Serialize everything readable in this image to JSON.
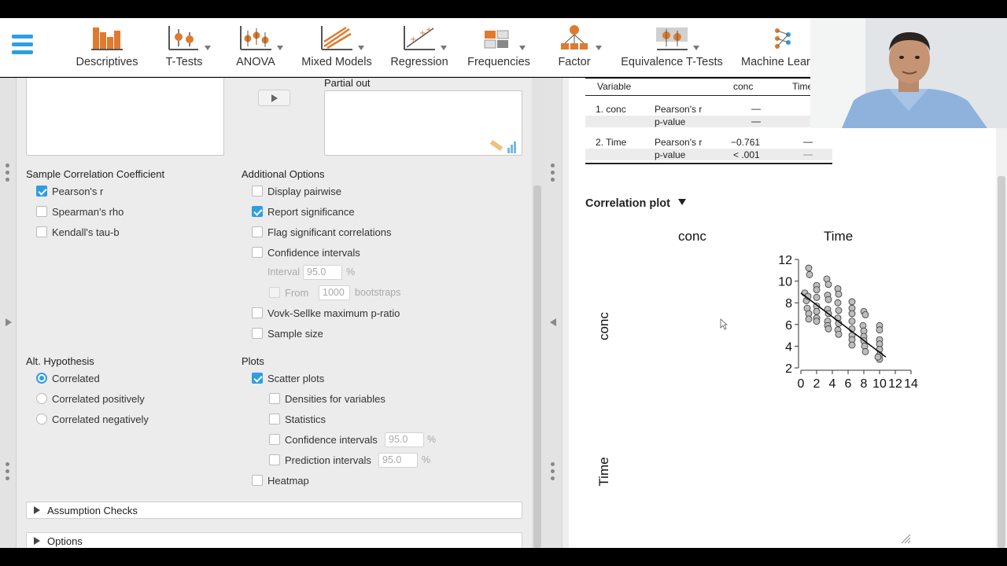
{
  "ribbon": {
    "items": [
      {
        "label": "Descriptives",
        "icon": "descriptives-icon"
      },
      {
        "label": "T-Tests",
        "icon": "t-tests-icon"
      },
      {
        "label": "ANOVA",
        "icon": "anova-icon"
      },
      {
        "label": "Mixed Models",
        "icon": "mixed-models-icon"
      },
      {
        "label": "Regression",
        "icon": "regression-icon"
      },
      {
        "label": "Frequencies",
        "icon": "frequencies-icon"
      },
      {
        "label": "Factor",
        "icon": "factor-icon"
      },
      {
        "label": "Equivalence T-Tests",
        "icon": "equivalence-icon"
      },
      {
        "label": "Machine Lear",
        "icon": "machine-learning-icon"
      }
    ]
  },
  "options": {
    "partial_out_label": "Partial out",
    "coefficient_heading": "Sample Correlation Coefficient",
    "coefficients": [
      {
        "label": "Pearson's r",
        "checked": true
      },
      {
        "label": "Spearman's rho",
        "checked": false
      },
      {
        "label": "Kendall's tau-b",
        "checked": false
      }
    ],
    "additional_heading": "Additional Options",
    "additional": {
      "display_pairwise": "Display pairwise",
      "report_significance": "Report significance",
      "flag_significant": "Flag significant correlations",
      "confidence_intervals": "Confidence intervals",
      "interval_label": "Interval",
      "interval_value": "95.0",
      "percent": "%",
      "from_label": "From",
      "bootstraps_value": "1000",
      "bootstraps_label": "bootstraps",
      "vovk_sellke": "Vovk-Sellke maximum p-ratio",
      "sample_size": "Sample size"
    },
    "hypothesis_heading": "Alt. Hypothesis",
    "hypotheses": [
      {
        "label": "Correlated",
        "selected": true
      },
      {
        "label": "Correlated positively",
        "selected": false
      },
      {
        "label": "Correlated negatively",
        "selected": false
      }
    ],
    "plots_heading": "Plots",
    "plots": {
      "scatter_plots": "Scatter plots",
      "densities": "Densities for variables",
      "statistics": "Statistics",
      "confidence_intervals": "Confidence intervals",
      "confidence_value": "95.0",
      "prediction_intervals": "Prediction intervals",
      "prediction_value": "95.0",
      "percent": "%",
      "heatmap": "Heatmap"
    },
    "sections": [
      "Assumption Checks",
      "Options"
    ]
  },
  "results": {
    "table": {
      "headers": [
        "Variable",
        "conc",
        "Time"
      ],
      "rows": [
        {
          "variable": "1. conc",
          "stat": "Pearson's r",
          "conc": "—",
          "time": ""
        },
        {
          "variable": "",
          "stat": "p-value",
          "conc": "—",
          "time": ""
        },
        {
          "variable": "2. Time",
          "stat": "Pearson's r",
          "conc": "−0.761",
          "time": "—"
        },
        {
          "variable": "",
          "stat": "p-value",
          "conc": "< .001",
          "time": "—"
        }
      ]
    },
    "plot_title": "Correlation plot",
    "matrix": {
      "col_labels": [
        "conc",
        "Time"
      ],
      "row_labels": [
        "conc",
        "Time"
      ]
    }
  },
  "chart_data": {
    "type": "scatter",
    "title": "",
    "xlabel": "",
    "ylabel": "",
    "xlim": [
      0,
      14
    ],
    "ylim": [
      2,
      12
    ],
    "x_ticks": [
      "0",
      "2",
      "4",
      "6",
      "8",
      "10",
      "12",
      "14"
    ],
    "y_ticks": [
      "2",
      "4",
      "6",
      "8",
      "10",
      "12"
    ],
    "points": [
      [
        0.5,
        8.9
      ],
      [
        0.7,
        8.2
      ],
      [
        0.8,
        7.5
      ],
      [
        0.9,
        8.6
      ],
      [
        1.0,
        11.2
      ],
      [
        1.1,
        10.6
      ],
      [
        1.0,
        7.0
      ],
      [
        1.0,
        6.5
      ],
      [
        2.0,
        9.6
      ],
      [
        2.0,
        9.2
      ],
      [
        2.0,
        8.5
      ],
      [
        2.0,
        7.7
      ],
      [
        2.0,
        7.2
      ],
      [
        2.0,
        6.6
      ],
      [
        2.0,
        6.3
      ],
      [
        3.3,
        10.2
      ],
      [
        3.5,
        9.7
      ],
      [
        3.4,
        8.7
      ],
      [
        3.5,
        8.3
      ],
      [
        3.4,
        7.4
      ],
      [
        3.5,
        7.0
      ],
      [
        3.4,
        6.3
      ],
      [
        3.4,
        5.9
      ],
      [
        3.5,
        5.6
      ],
      [
        4.7,
        9.3
      ],
      [
        4.8,
        8.8
      ],
      [
        4.7,
        8.0
      ],
      [
        4.8,
        7.3
      ],
      [
        4.7,
        6.6
      ],
      [
        4.8,
        6.1
      ],
      [
        4.7,
        5.5
      ],
      [
        4.8,
        5.1
      ],
      [
        6.5,
        8.1
      ],
      [
        6.5,
        7.5
      ],
      [
        6.5,
        7.0
      ],
      [
        6.5,
        6.3
      ],
      [
        6.5,
        5.6
      ],
      [
        6.5,
        5.0
      ],
      [
        6.5,
        4.6
      ],
      [
        6.5,
        4.1
      ],
      [
        8.0,
        7.2
      ],
      [
        8.2,
        6.9
      ],
      [
        7.9,
        5.9
      ],
      [
        8.0,
        5.4
      ],
      [
        8.0,
        4.9
      ],
      [
        8.0,
        4.5
      ],
      [
        8.1,
        4.0
      ],
      [
        8.2,
        3.5
      ],
      [
        10.0,
        5.9
      ],
      [
        10.0,
        5.5
      ],
      [
        10.0,
        4.6
      ],
      [
        10.0,
        4.2
      ],
      [
        10.0,
        3.7
      ],
      [
        10.0,
        3.2
      ],
      [
        10.0,
        2.8
      ],
      [
        9.8,
        3.0
      ]
    ],
    "fit_line": {
      "x": [
        0.0,
        10.8
      ],
      "y": [
        8.9,
        3.0
      ]
    },
    "marker_color": "#bdbdbd",
    "line_color": "#000000"
  }
}
